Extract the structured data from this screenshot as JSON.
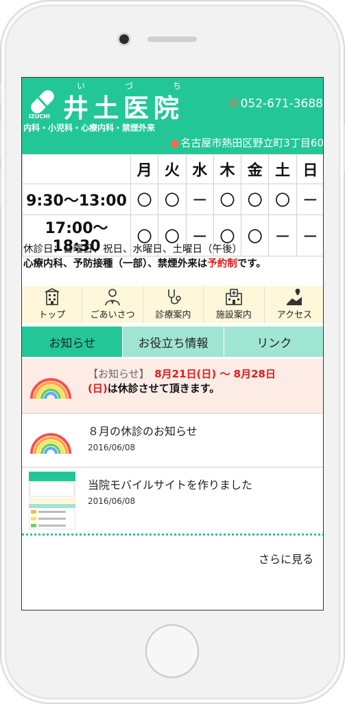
{
  "header": {
    "logo_text": "IZUCHI",
    "ruby": "い　づ　ち",
    "clinic_name": "井土医院",
    "phone": "052-671-3688",
    "specialties": "内科・小児科・心療内科・禁煙外来",
    "address": "名古屋市熱田区野立町3丁目60"
  },
  "schedule": {
    "days": [
      "月",
      "火",
      "水",
      "木",
      "金",
      "土",
      "日"
    ],
    "rows": [
      {
        "time": "9:30〜13:00",
        "marks": [
          "〇",
          "〇",
          "ー",
          "〇",
          "〇",
          "〇",
          "ー"
        ]
      },
      {
        "time": "17:00〜18:30",
        "marks": [
          "〇",
          "〇",
          "ー",
          "〇",
          "〇",
          "ー",
          "ー"
        ]
      }
    ]
  },
  "notes": {
    "closed": "休診日：日曜日、祝日、水曜日、土曜日（午後）",
    "line2_prefix": "心療内科、予防接種（一部）、禁煙外来は",
    "line2_highlight": "予約制",
    "line2_suffix": "です。"
  },
  "nav": [
    {
      "label": "トップ",
      "icon": "building-icon"
    },
    {
      "label": "ごあいさつ",
      "icon": "doctor-icon"
    },
    {
      "label": "診療案内",
      "icon": "stethoscope-icon"
    },
    {
      "label": "施設案内",
      "icon": "hospital-icon"
    },
    {
      "label": "アクセス",
      "icon": "map-pin-icon"
    }
  ],
  "tabs": [
    {
      "label": "お知らせ",
      "active": true
    },
    {
      "label": "お役立ち情報",
      "active": false
    },
    {
      "label": "リンク",
      "active": false
    }
  ],
  "news": [
    {
      "tag": "【お知らせ】",
      "date_range": "8月21日(日) 〜 8月28日",
      "date_end": "(日)",
      "body": "は休診させて頂きます。",
      "thumb": "rainbow-icon"
    },
    {
      "title": "８月の休診のお知らせ",
      "date": "2016/06/08",
      "thumb": "rainbow-icon"
    },
    {
      "title": "当院モバイルサイトを作りました",
      "date": "2016/06/08",
      "thumb": "site-screenshot-thumbnail"
    }
  ],
  "more_label": "さらに見る",
  "colors": {
    "accent": "#23c797",
    "tab_inactive": "#9fe5d1",
    "nav_bg": "#fff7da",
    "highlight_bg": "#fdece6",
    "red": "#e41b1b",
    "icon_orange": "#ff6b4a"
  }
}
